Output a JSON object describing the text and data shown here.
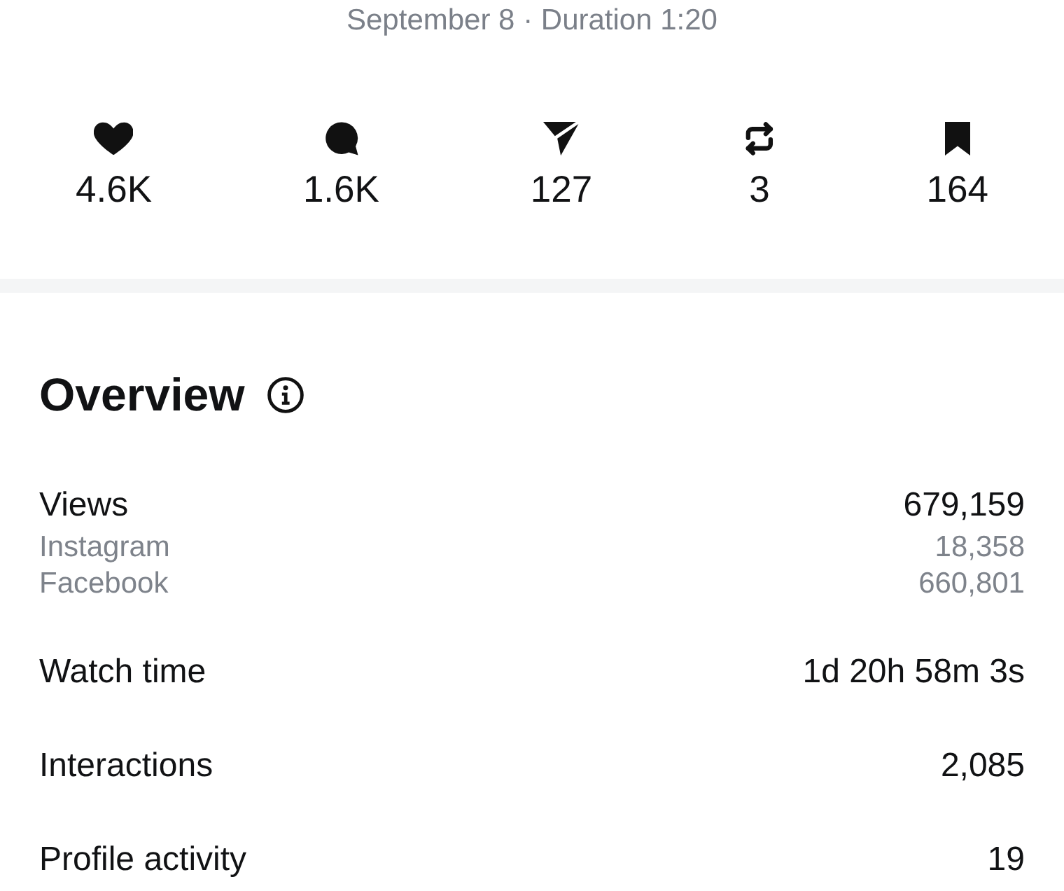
{
  "header": {
    "date_line": "September 8 · Duration 1:20"
  },
  "stats": [
    {
      "kind": "likes",
      "count": "4.6K"
    },
    {
      "kind": "comments",
      "count": "1.6K"
    },
    {
      "kind": "shares",
      "count": "127"
    },
    {
      "kind": "reposts",
      "count": "3"
    },
    {
      "kind": "saves",
      "count": "164"
    }
  ],
  "overview": {
    "title": "Overview",
    "metrics": [
      {
        "label": "Views",
        "value": "679,159",
        "breakdown": [
          {
            "label": "Instagram",
            "value": "18,358"
          },
          {
            "label": "Facebook",
            "value": "660,801"
          }
        ]
      },
      {
        "label": "Watch time",
        "value": "1d 20h 58m 3s"
      },
      {
        "label": "Interactions",
        "value": "2,085"
      },
      {
        "label": "Profile activity",
        "value": "19"
      }
    ]
  }
}
